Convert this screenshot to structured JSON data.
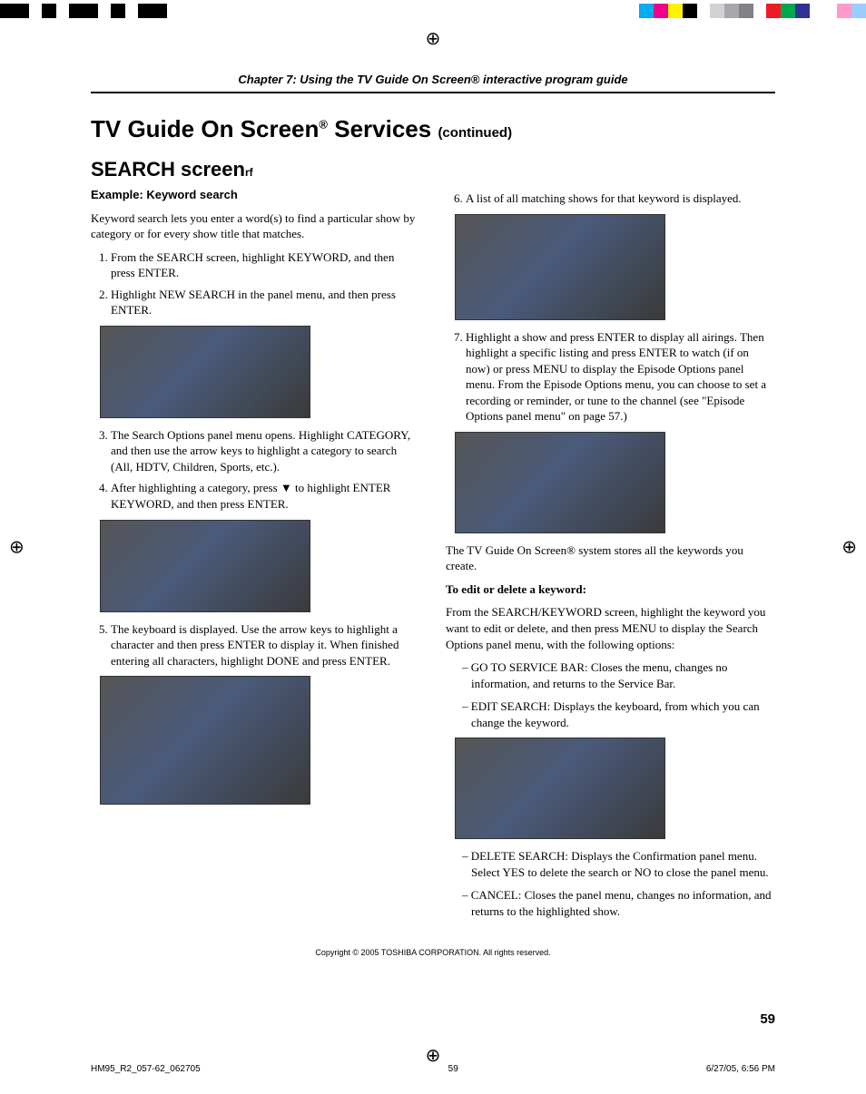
{
  "chapter_header": "Chapter 7: Using the TV Guide On Screen® interactive program guide",
  "main_title": {
    "a": "TV Guide On Screen",
    "sup": "®",
    "b": " Services ",
    "cont": "(continued)"
  },
  "subtitle": {
    "a": "SEARCH screen",
    "sub": "rf"
  },
  "left": {
    "example_head": "Example: Keyword search",
    "intro": "Keyword search lets you enter a word(s) to find a particular show by category or for every show title that matches.",
    "step1": "From the SEARCH screen, highlight KEYWORD, and then press ENTER.",
    "step2": "Highlight NEW SEARCH in the panel menu, and then press ENTER.",
    "step3": "The Search Options panel menu opens. Highlight CATEGORY, and then use the arrow keys to highlight a category to search (All, HDTV, Children, Sports, etc.).",
    "step4": "After highlighting a category, press ▼ to highlight ENTER KEYWORD, and then press ENTER.",
    "step5": "The keyboard is displayed. Use the arrow keys to highlight a character and then press ENTER to display it. When finished entering all characters, highlight DONE and press ENTER."
  },
  "right": {
    "step6": "A list of all matching shows for that keyword is displayed.",
    "step7": "Highlight a show and press ENTER to display all airings. Then highlight a specific listing and press ENTER to watch (if on now) or press MENU to display the Episode Options panel menu. From the Episode Options menu, you can choose to set a recording or reminder, or tune to the channel (see \"Episode Options panel menu\" on page 57.)",
    "stores": "The TV Guide On Screen® system stores all the keywords you create.",
    "edit_head": "To edit or delete a keyword:",
    "edit_body": "From the SEARCH/KEYWORD screen, highlight the keyword you want to edit or delete, and then press MENU to display the Search Options panel menu, with the following options:",
    "opt1": "– GO TO SERVICE BAR: Closes the menu, changes no information, and returns to the Service Bar.",
    "opt2": "– EDIT SEARCH: Displays the keyboard, from which you can change the keyword.",
    "opt3": "– DELETE SEARCH: Displays the Confirmation panel menu. Select YES to delete the search or NO to close the panel menu.",
    "opt4": "– CANCEL: Closes the panel menu, changes no information, and returns to the highlighted show."
  },
  "copyright": "Copyright © 2005 TOSHIBA CORPORATION. All rights reserved.",
  "page_number": "59",
  "footer": {
    "file": "HM95_R2_057-62_062705",
    "page": "59",
    "date": "6/27/05, 6:56 PM"
  },
  "colorbar_left": [
    "#000",
    "#000",
    "#fff",
    "#000",
    "#fff",
    "#000",
    "#000",
    "#fff",
    "#000",
    "#fff",
    "#000",
    "#000"
  ],
  "colorbar_right": [
    "#00adee",
    "#ec008c",
    "#fff200",
    "#000",
    "#d0d2d3",
    "#a6a8ab",
    "#808284",
    "#ed1c24",
    "#00a650",
    "#2e3192",
    "#fff",
    "#f9c",
    "#9cf"
  ]
}
